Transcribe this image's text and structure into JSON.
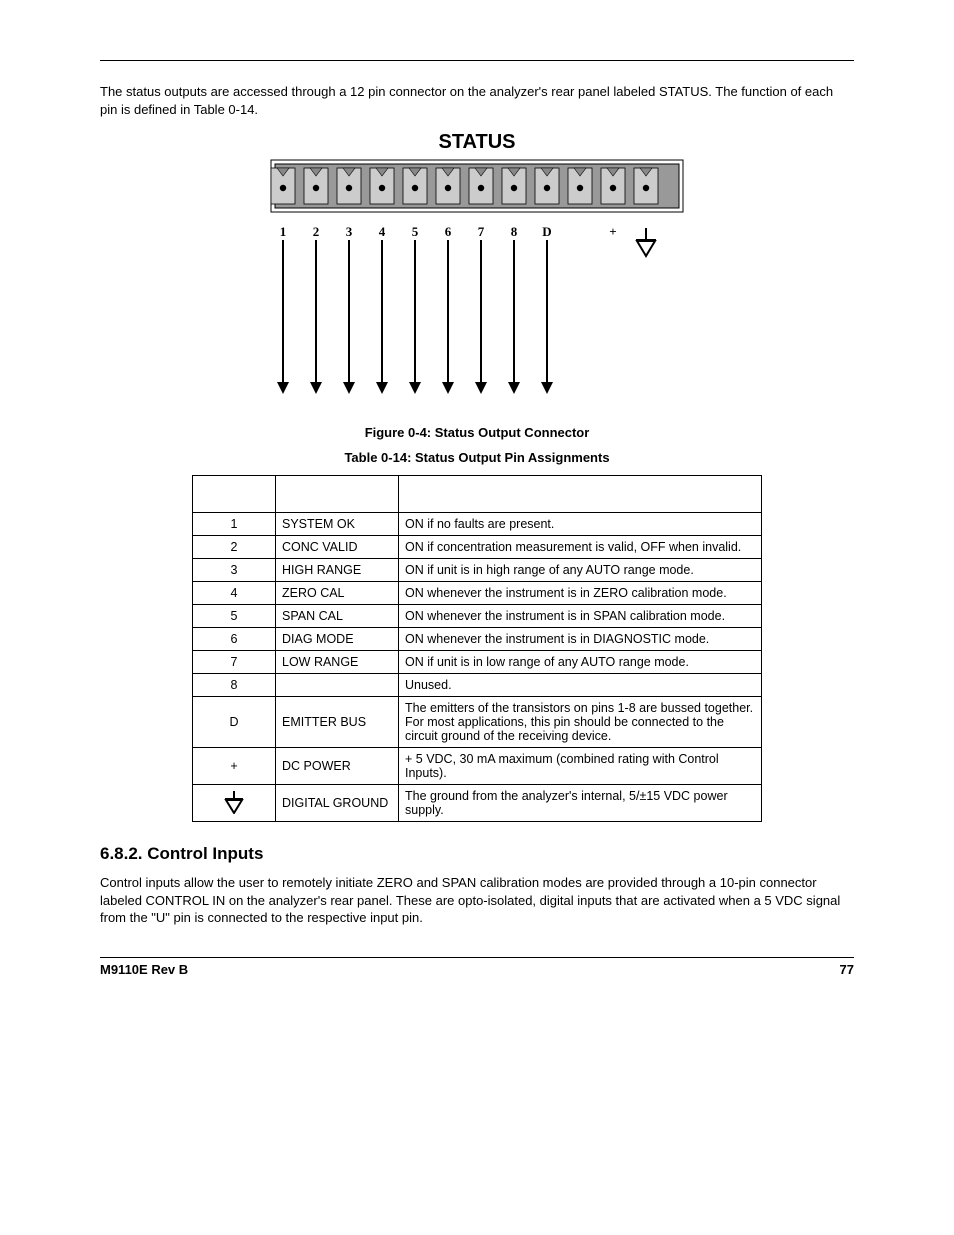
{
  "intro": "The status outputs are accessed through a 12 pin connector on the analyzer's rear panel labeled STATUS. The function of each pin is defined in Table 0-14.",
  "diagram": {
    "title": "STATUS",
    "labels": [
      "1",
      "2",
      "3",
      "4",
      "5",
      "6",
      "7",
      "8",
      "D",
      "",
      "+",
      ""
    ]
  },
  "figure_caption": "Figure 0-4:   Status Output Connector",
  "table_caption": "Table 0-14:  Status Output Pin Assignments",
  "table": {
    "rows": [
      {
        "pin": "1",
        "name": "SYSTEM OK",
        "cond": "ON if no faults are present."
      },
      {
        "pin": "2",
        "name": "CONC VALID",
        "cond": "ON if concentration measurement is valid, OFF when invalid."
      },
      {
        "pin": "3",
        "name": "HIGH RANGE",
        "cond": "ON if unit is in high range of any AUTO range mode."
      },
      {
        "pin": "4",
        "name": "ZERO CAL",
        "cond": "ON whenever the instrument is in ZERO calibration mode."
      },
      {
        "pin": "5",
        "name": "SPAN CAL",
        "cond": "ON whenever the instrument is in SPAN calibration mode."
      },
      {
        "pin": "6",
        "name": "DIAG MODE",
        "cond": "ON whenever the instrument is in DIAGNOSTIC mode."
      },
      {
        "pin": "7",
        "name": "LOW RANGE",
        "cond": "ON if unit is in low range of any AUTO range mode."
      },
      {
        "pin": "8",
        "name": "",
        "cond": "Unused."
      },
      {
        "pin": "D",
        "name": "EMITTER BUS",
        "cond": "The emitters of the transistors on pins 1-8 are bussed together. For most applications, this pin should be connected to the circuit ground of the receiving device."
      },
      {
        "pin": "+",
        "name": "DC POWER",
        "cond": "+ 5 VDC, 30 mA maximum (combined rating with Control Inputs)."
      },
      {
        "pin": "GND",
        "name": "DIGITAL GROUND",
        "cond": "The ground from the analyzer's internal, 5/±15 VDC power supply."
      }
    ]
  },
  "section_heading": "6.8.2. Control Inputs",
  "section_body": "Control inputs allow the user to remotely initiate ZERO and SPAN calibration modes are provided through a 10-pin connector labeled CONTROL IN on the analyzer's rear panel. These are opto-isolated, digital inputs that are activated when a 5 VDC signal from the \"U\" pin is connected to the respective input pin.",
  "footer_left": "M9110E Rev B",
  "footer_right": "77"
}
